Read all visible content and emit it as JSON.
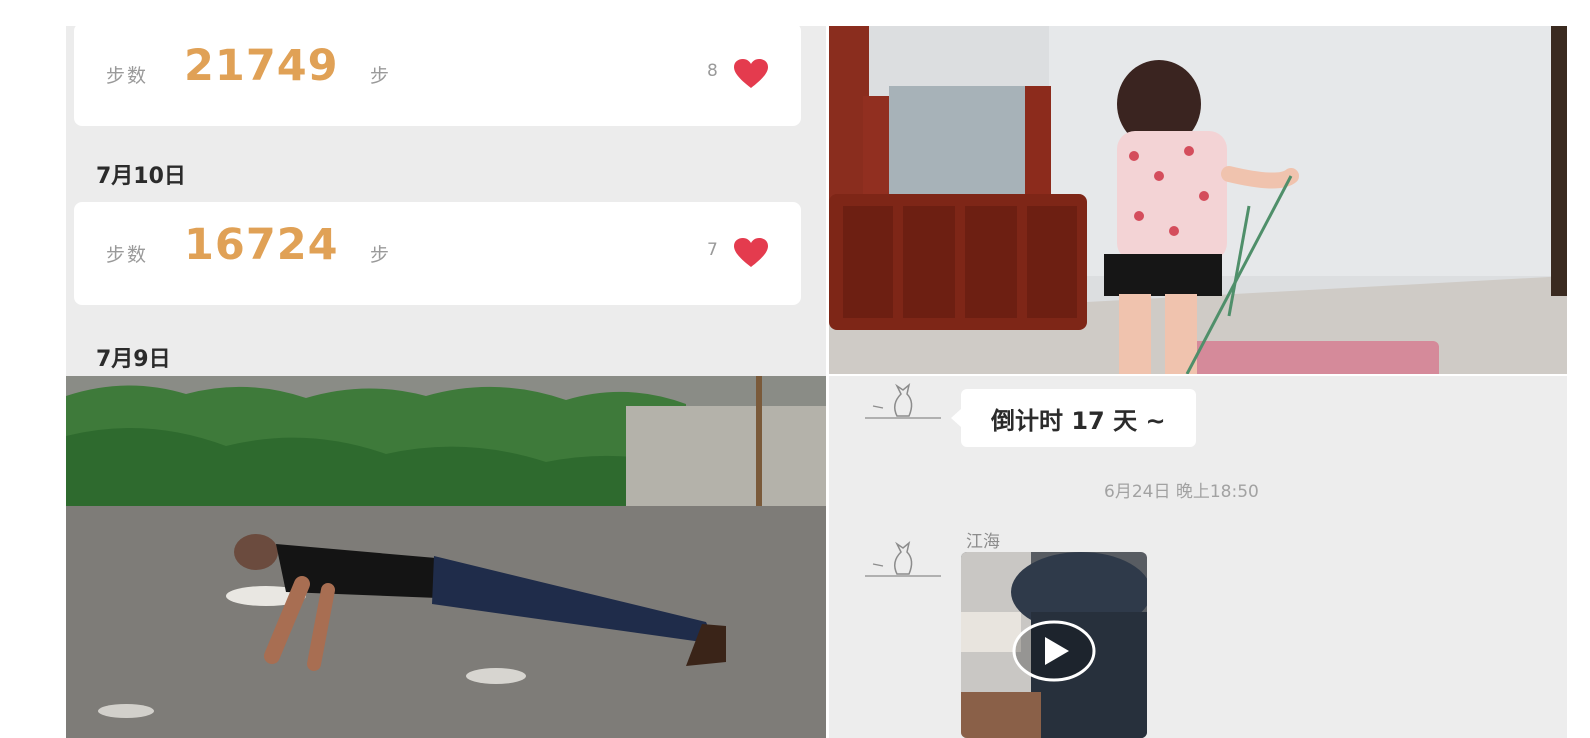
{
  "step_log": {
    "entries": [
      {
        "label": "步数",
        "value": "21749",
        "unit": "步",
        "likes": "8"
      },
      {
        "label": "步数",
        "value": "16724",
        "unit": "步",
        "likes": "7"
      }
    ],
    "dates": [
      "7月10日",
      "7月9日"
    ]
  },
  "chat": {
    "message_text": "倒计时 17 天 ~",
    "timestamp": "6月24日 晚上18:50",
    "sender_name": "江海",
    "icons": {
      "avatar": "cat-sketch-avatar-icon",
      "like": "heart-icon",
      "video": "play-icon"
    }
  },
  "colors": {
    "step_value": "#e0a156",
    "heart": "#e43b4e",
    "panel_background": "#ececec"
  }
}
